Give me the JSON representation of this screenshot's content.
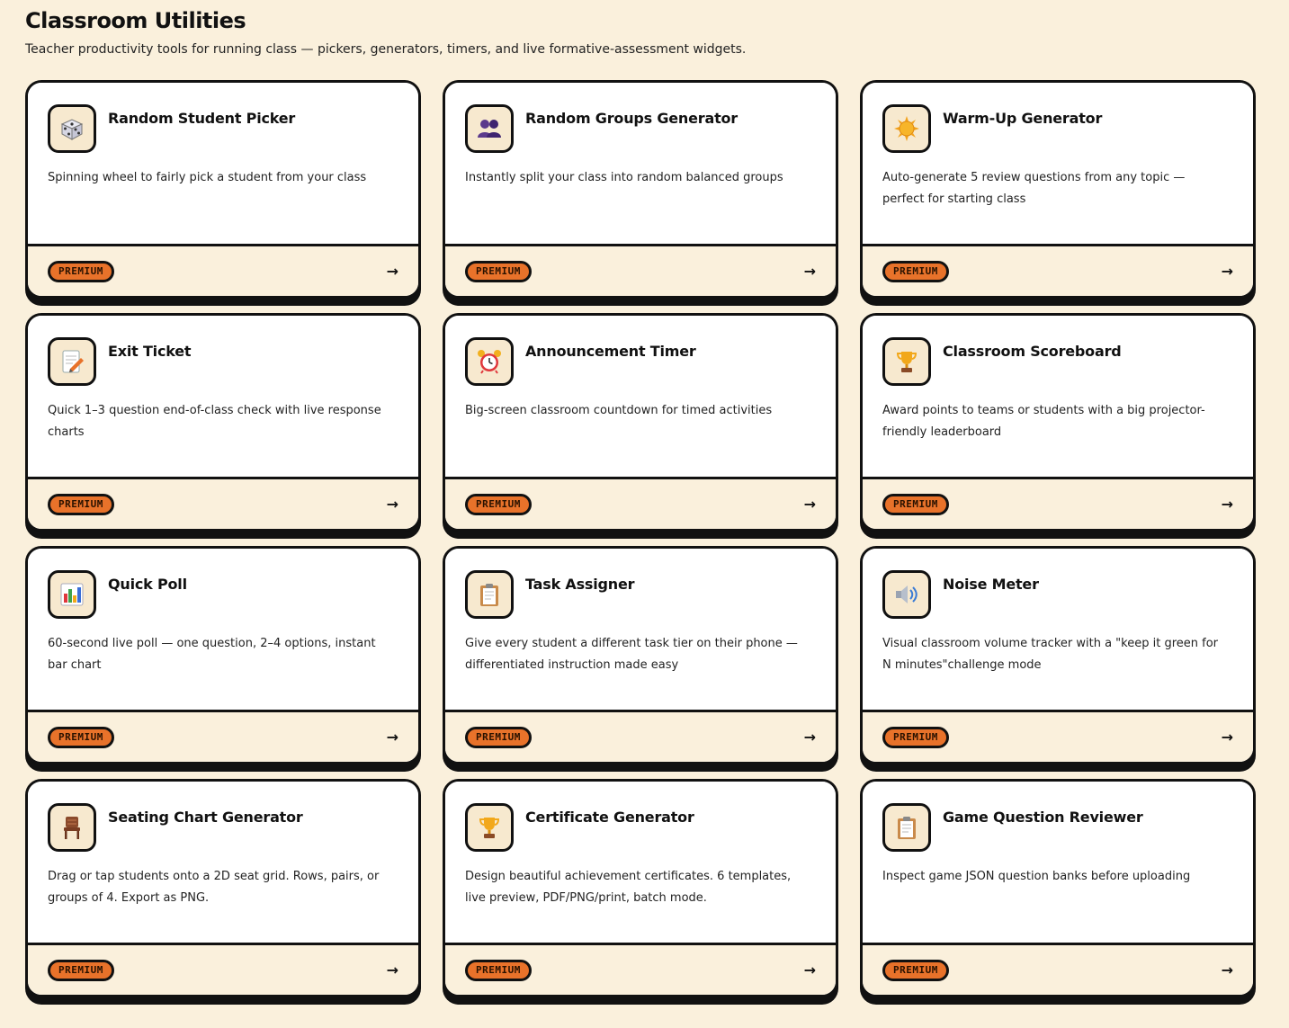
{
  "header": {
    "title": "Classroom Utilities",
    "subtitle": "Teacher productivity tools for running class — pickers, generators, timers, and live formative-assessment widgets."
  },
  "cards": [
    {
      "title": "Random Student Picker",
      "description": "Spinning wheel to fairly pick a student from your class",
      "badge": "PREMIUM",
      "arrow": "→",
      "icon": "dice-icon"
    },
    {
      "title": "Random Groups Generator",
      "description": "Instantly split your class into random balanced groups",
      "badge": "PREMIUM",
      "arrow": "→",
      "icon": "people-icon"
    },
    {
      "title": "Warm-Up Generator",
      "description": "Auto-generate 5 review questions from any topic — perfect for starting class",
      "badge": "PREMIUM",
      "arrow": "→",
      "icon": "sun-icon"
    },
    {
      "title": "Exit Ticket",
      "description": "Quick 1–3 question end-of-class check with live response charts",
      "badge": "PREMIUM",
      "arrow": "→",
      "icon": "memo-icon"
    },
    {
      "title": "Announcement Timer",
      "description": "Big-screen classroom countdown for timed activities",
      "badge": "PREMIUM",
      "arrow": "→",
      "icon": "alarm-clock-icon"
    },
    {
      "title": "Classroom Scoreboard",
      "description": "Award points to teams or students with a big projector-friendly leaderboard",
      "badge": "PREMIUM",
      "arrow": "→",
      "icon": "trophy-icon"
    },
    {
      "title": "Quick Poll",
      "description": "60-second live poll — one question, 2–4 options, instant bar chart",
      "badge": "PREMIUM",
      "arrow": "→",
      "icon": "bar-chart-icon"
    },
    {
      "title": "Task Assigner",
      "description": "Give every student a different task tier on their phone — differentiated instruction made easy",
      "badge": "PREMIUM",
      "arrow": "→",
      "icon": "clipboard-icon"
    },
    {
      "title": "Noise Meter",
      "description": "Visual classroom volume tracker with a \"keep it green for N minutes\"challenge mode",
      "badge": "PREMIUM",
      "arrow": "→",
      "icon": "speaker-icon"
    },
    {
      "title": "Seating Chart Generator",
      "description": "Drag or tap students onto a 2D seat grid. Rows, pairs, or groups of 4. Export as PNG.",
      "badge": "PREMIUM",
      "arrow": "→",
      "icon": "chair-icon"
    },
    {
      "title": "Certificate Generator",
      "description": "Design beautiful achievement certificates. 6 templates, live preview, PDF/PNG/print, batch mode.",
      "badge": "PREMIUM",
      "arrow": "→",
      "icon": "trophy-icon"
    },
    {
      "title": "Game Question Reviewer",
      "description": "Inspect game JSON question banks before uploading",
      "badge": "PREMIUM",
      "arrow": "→",
      "icon": "clipboard-icon"
    }
  ],
  "colors": {
    "background": "#faf0dc",
    "badge": "#e8722a",
    "border": "#111111",
    "icon_bg": "#f7e9cf"
  }
}
